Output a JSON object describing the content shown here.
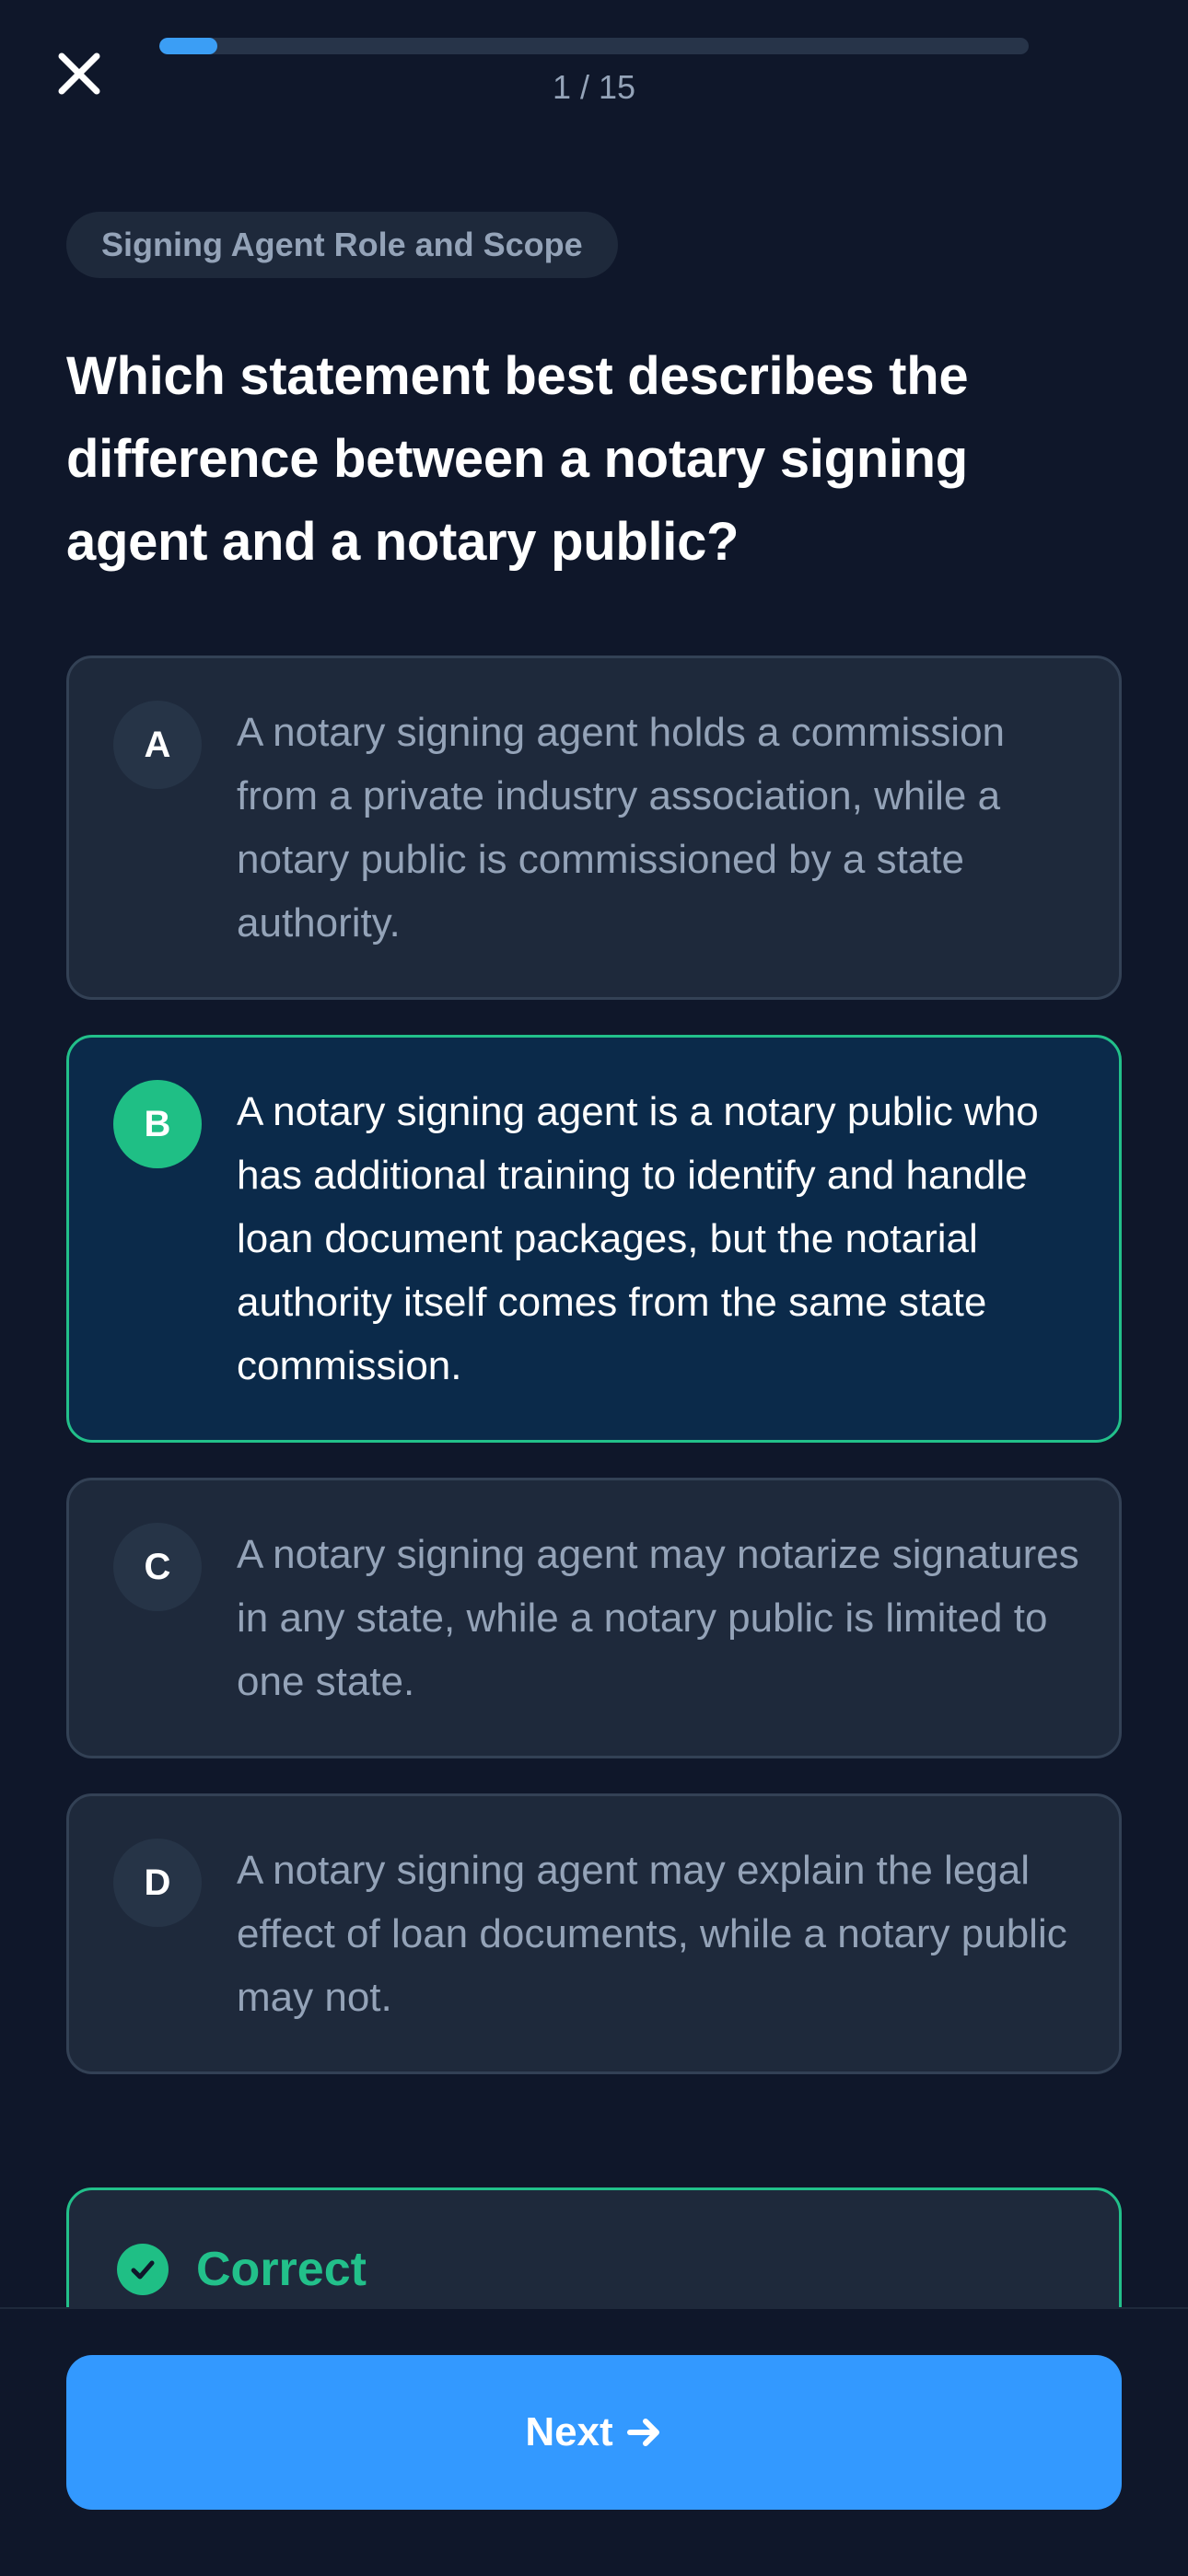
{
  "header": {
    "progress_text": "1 / 15",
    "progress_fraction": 0.0667,
    "close_icon": "close-icon"
  },
  "question": {
    "category": "Signing Agent Role and Scope",
    "text": "Which statement best describes the difference between a notary signing agent and a notary public?"
  },
  "options": [
    {
      "letter": "A",
      "text": "A notary signing agent holds a commission from a private industry association, while a notary public is commissioned by a state authority.",
      "selected": false
    },
    {
      "letter": "B",
      "text": "A notary signing agent is a notary public who has additional training to identify and handle loan document packages, but the notarial authority itself comes from the same state commission.",
      "selected": true
    },
    {
      "letter": "C",
      "text": "A notary signing agent may notarize signatures in any state, while a notary public is limited to one state.",
      "selected": false
    },
    {
      "letter": "D",
      "text": "A notary signing agent may explain the legal effect of loan documents, while a notary public may not.",
      "selected": false
    }
  ],
  "feedback": {
    "title": "Correct",
    "icon": "check-circle-icon"
  },
  "footer": {
    "next_label": "Next",
    "next_icon": "arrow-right-icon"
  },
  "colors": {
    "background": "#0f172a",
    "card": "#1e293b",
    "accent_blue": "#3399ff",
    "correct_green": "#22c08a",
    "selected_bg": "#0b2a4a"
  }
}
